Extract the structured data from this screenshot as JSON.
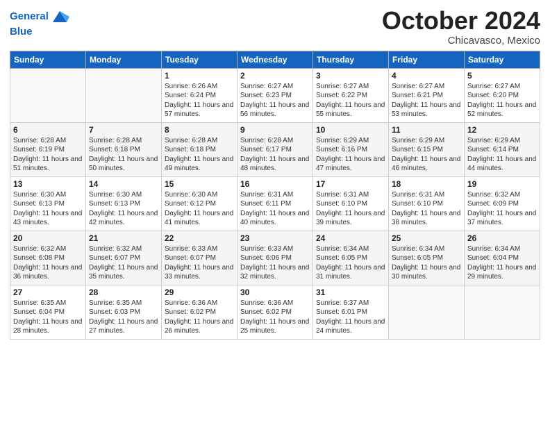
{
  "header": {
    "logo_line1": "General",
    "logo_line2": "Blue",
    "month": "October 2024",
    "location": "Chicavasco, Mexico"
  },
  "weekdays": [
    "Sunday",
    "Monday",
    "Tuesday",
    "Wednesday",
    "Thursday",
    "Friday",
    "Saturday"
  ],
  "weeks": [
    [
      {
        "day": "",
        "info": ""
      },
      {
        "day": "",
        "info": ""
      },
      {
        "day": "1",
        "info": "Sunrise: 6:26 AM\nSunset: 6:24 PM\nDaylight: 11 hours and 57 minutes."
      },
      {
        "day": "2",
        "info": "Sunrise: 6:27 AM\nSunset: 6:23 PM\nDaylight: 11 hours and 56 minutes."
      },
      {
        "day": "3",
        "info": "Sunrise: 6:27 AM\nSunset: 6:22 PM\nDaylight: 11 hours and 55 minutes."
      },
      {
        "day": "4",
        "info": "Sunrise: 6:27 AM\nSunset: 6:21 PM\nDaylight: 11 hours and 53 minutes."
      },
      {
        "day": "5",
        "info": "Sunrise: 6:27 AM\nSunset: 6:20 PM\nDaylight: 11 hours and 52 minutes."
      }
    ],
    [
      {
        "day": "6",
        "info": "Sunrise: 6:28 AM\nSunset: 6:19 PM\nDaylight: 11 hours and 51 minutes."
      },
      {
        "day": "7",
        "info": "Sunrise: 6:28 AM\nSunset: 6:18 PM\nDaylight: 11 hours and 50 minutes."
      },
      {
        "day": "8",
        "info": "Sunrise: 6:28 AM\nSunset: 6:18 PM\nDaylight: 11 hours and 49 minutes."
      },
      {
        "day": "9",
        "info": "Sunrise: 6:28 AM\nSunset: 6:17 PM\nDaylight: 11 hours and 48 minutes."
      },
      {
        "day": "10",
        "info": "Sunrise: 6:29 AM\nSunset: 6:16 PM\nDaylight: 11 hours and 47 minutes."
      },
      {
        "day": "11",
        "info": "Sunrise: 6:29 AM\nSunset: 6:15 PM\nDaylight: 11 hours and 46 minutes."
      },
      {
        "day": "12",
        "info": "Sunrise: 6:29 AM\nSunset: 6:14 PM\nDaylight: 11 hours and 44 minutes."
      }
    ],
    [
      {
        "day": "13",
        "info": "Sunrise: 6:30 AM\nSunset: 6:13 PM\nDaylight: 11 hours and 43 minutes."
      },
      {
        "day": "14",
        "info": "Sunrise: 6:30 AM\nSunset: 6:13 PM\nDaylight: 11 hours and 42 minutes."
      },
      {
        "day": "15",
        "info": "Sunrise: 6:30 AM\nSunset: 6:12 PM\nDaylight: 11 hours and 41 minutes."
      },
      {
        "day": "16",
        "info": "Sunrise: 6:31 AM\nSunset: 6:11 PM\nDaylight: 11 hours and 40 minutes."
      },
      {
        "day": "17",
        "info": "Sunrise: 6:31 AM\nSunset: 6:10 PM\nDaylight: 11 hours and 39 minutes."
      },
      {
        "day": "18",
        "info": "Sunrise: 6:31 AM\nSunset: 6:10 PM\nDaylight: 11 hours and 38 minutes."
      },
      {
        "day": "19",
        "info": "Sunrise: 6:32 AM\nSunset: 6:09 PM\nDaylight: 11 hours and 37 minutes."
      }
    ],
    [
      {
        "day": "20",
        "info": "Sunrise: 6:32 AM\nSunset: 6:08 PM\nDaylight: 11 hours and 36 minutes."
      },
      {
        "day": "21",
        "info": "Sunrise: 6:32 AM\nSunset: 6:07 PM\nDaylight: 11 hours and 35 minutes."
      },
      {
        "day": "22",
        "info": "Sunrise: 6:33 AM\nSunset: 6:07 PM\nDaylight: 11 hours and 33 minutes."
      },
      {
        "day": "23",
        "info": "Sunrise: 6:33 AM\nSunset: 6:06 PM\nDaylight: 11 hours and 32 minutes."
      },
      {
        "day": "24",
        "info": "Sunrise: 6:34 AM\nSunset: 6:05 PM\nDaylight: 11 hours and 31 minutes."
      },
      {
        "day": "25",
        "info": "Sunrise: 6:34 AM\nSunset: 6:05 PM\nDaylight: 11 hours and 30 minutes."
      },
      {
        "day": "26",
        "info": "Sunrise: 6:34 AM\nSunset: 6:04 PM\nDaylight: 11 hours and 29 minutes."
      }
    ],
    [
      {
        "day": "27",
        "info": "Sunrise: 6:35 AM\nSunset: 6:04 PM\nDaylight: 11 hours and 28 minutes."
      },
      {
        "day": "28",
        "info": "Sunrise: 6:35 AM\nSunset: 6:03 PM\nDaylight: 11 hours and 27 minutes."
      },
      {
        "day": "29",
        "info": "Sunrise: 6:36 AM\nSunset: 6:02 PM\nDaylight: 11 hours and 26 minutes."
      },
      {
        "day": "30",
        "info": "Sunrise: 6:36 AM\nSunset: 6:02 PM\nDaylight: 11 hours and 25 minutes."
      },
      {
        "day": "31",
        "info": "Sunrise: 6:37 AM\nSunset: 6:01 PM\nDaylight: 11 hours and 24 minutes."
      },
      {
        "day": "",
        "info": ""
      },
      {
        "day": "",
        "info": ""
      }
    ]
  ]
}
